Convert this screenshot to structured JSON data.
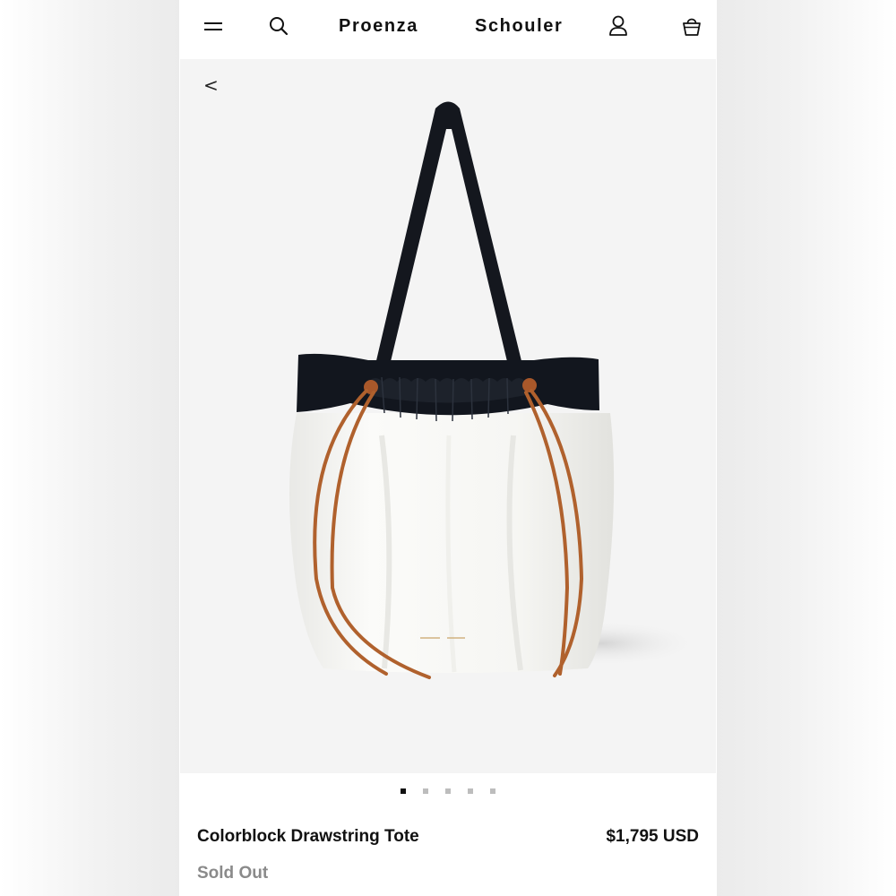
{
  "header": {
    "brand_left": "Proenza",
    "brand_right": "Schouler",
    "icons": [
      "menu-icon",
      "search-icon",
      "account-icon",
      "bag-icon"
    ]
  },
  "gallery": {
    "back_label": "<",
    "image_count": 5,
    "active_index": 0
  },
  "product": {
    "name": "Colorblock Drawstring Tote",
    "price": "$1,795 USD",
    "status": "Sold Out"
  },
  "colors": {
    "bag_body": "#f7f7f5",
    "bag_trim": "#12161e",
    "drawstring": "#b0612d",
    "gallery_bg": "#f4f4f4",
    "sold_out_text": "#8a8a8a"
  }
}
